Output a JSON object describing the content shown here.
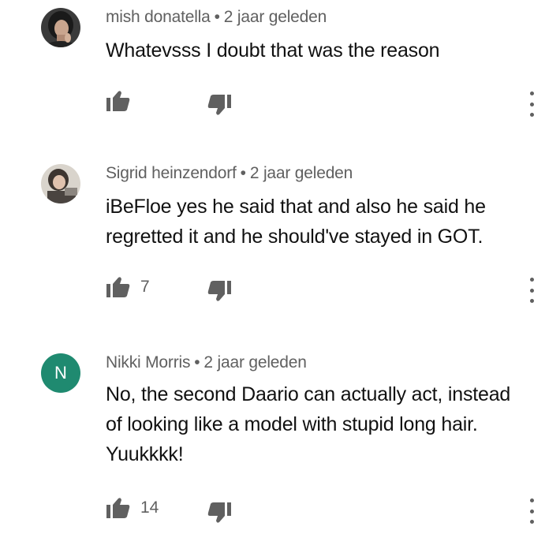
{
  "comments": [
    {
      "author": "mish donatella",
      "separator": "•",
      "time": "2 jaar geleden",
      "text": "Whatevsss I doubt that was the reason",
      "likes": "",
      "avatar_icon": "profile-photo"
    },
    {
      "author": "Sigrid heinzendorf",
      "separator": "•",
      "time": "2 jaar geleden",
      "text": "iBeFloe yes he said that and also he said he regretted it and he should've stayed in GOT.",
      "likes": "7",
      "avatar_icon": "profile-photo"
    },
    {
      "author": "Nikki Morris",
      "separator": "•",
      "time": "2 jaar geleden",
      "text": "No, the second Daario can actually act, instead of looking like a model with stupid long hair.  Yuukkkk!",
      "likes": "14",
      "avatar_letter": "N",
      "avatar_color": "#1f8a70"
    }
  ],
  "icons": {
    "like": "thumbs-up-icon",
    "dislike": "thumbs-down-icon",
    "menu": "more-vert-icon"
  },
  "colors": {
    "text": "#111111",
    "meta": "#606060",
    "background": "#ffffff"
  }
}
